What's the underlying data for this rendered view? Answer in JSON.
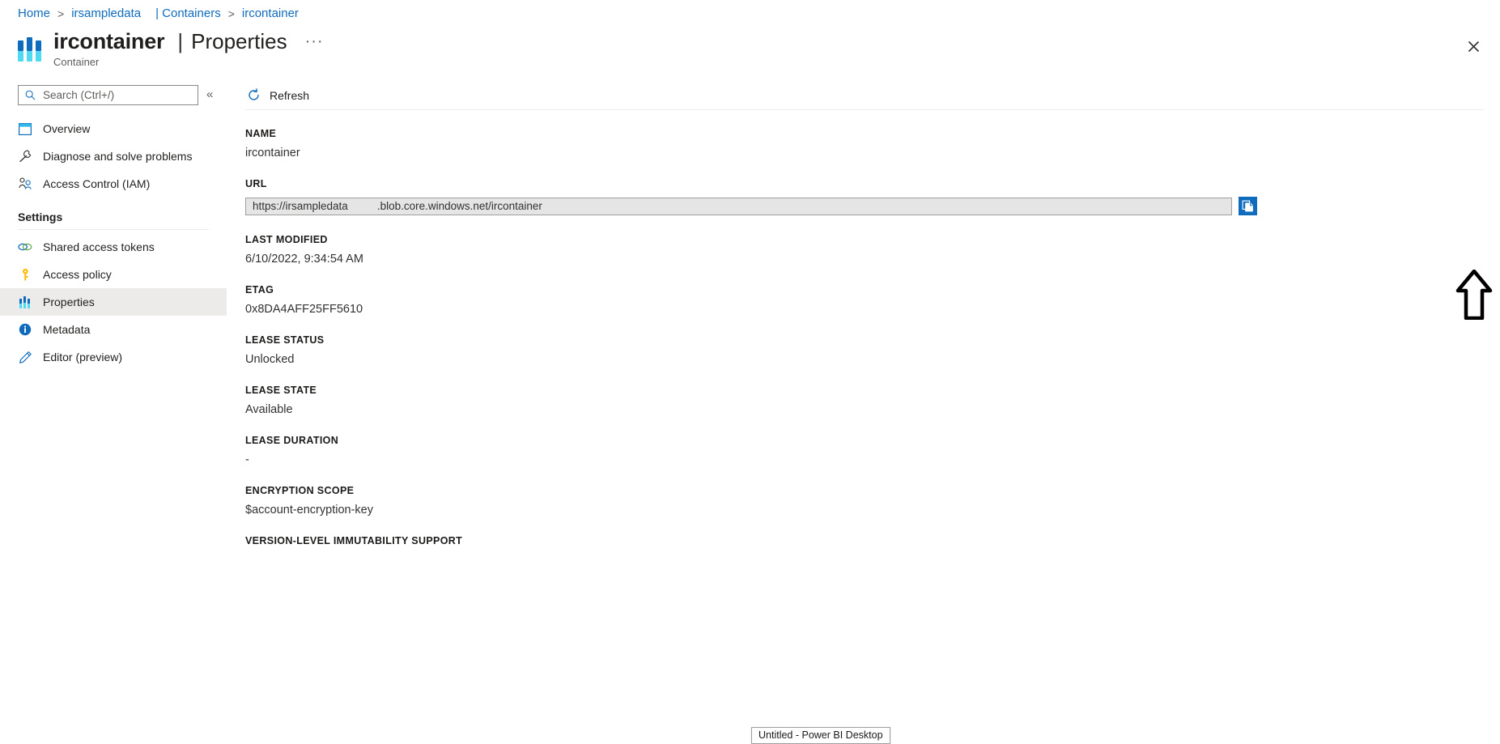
{
  "breadcrumb": {
    "items": [
      {
        "label": "Home",
        "sep": ">"
      },
      {
        "label": "irsampledata",
        "sep": ""
      },
      {
        "label": "| Containers",
        "sep": ">"
      },
      {
        "label": "ircontainer",
        "sep": ""
      }
    ]
  },
  "header": {
    "title": "ircontainer",
    "separator": "|",
    "page": "Properties",
    "more_label": "···",
    "subtitle": "Container",
    "close_label": "✕"
  },
  "sidebar": {
    "search_placeholder": "Search (Ctrl+/)",
    "search_value": "",
    "collapse_label": "«",
    "items": [
      {
        "label": "Overview",
        "icon": "overview-icon",
        "selected": false
      },
      {
        "label": "Diagnose and solve problems",
        "icon": "wrench-icon",
        "selected": false
      },
      {
        "label": "Access Control (IAM)",
        "icon": "people-icon",
        "selected": false
      }
    ],
    "group_label": "Settings",
    "settings_items": [
      {
        "label": "Shared access tokens",
        "icon": "link-icon",
        "selected": false
      },
      {
        "label": "Access policy",
        "icon": "key-icon",
        "selected": false
      },
      {
        "label": "Properties",
        "icon": "container-icon",
        "selected": true
      },
      {
        "label": "Metadata",
        "icon": "info-icon",
        "selected": false
      },
      {
        "label": "Editor (preview)",
        "icon": "pencil-icon",
        "selected": false
      }
    ]
  },
  "toolbar": {
    "refresh_label": "Refresh"
  },
  "properties": [
    {
      "label": "NAME",
      "value": "ircontainer",
      "type": "text"
    },
    {
      "label": "URL",
      "type": "url",
      "url_prefix": "https://irsampledata",
      "url_suffix": ".blob.core.windows.net/ircontainer",
      "copy_title": "Copy to clipboard"
    },
    {
      "label": "LAST MODIFIED",
      "value": "6/10/2022, 9:34:54 AM",
      "type": "text"
    },
    {
      "label": "ETAG",
      "value": "0x8DA4AFF25FF5610",
      "type": "text"
    },
    {
      "label": "LEASE STATUS",
      "value": "Unlocked",
      "type": "text"
    },
    {
      "label": "LEASE STATE",
      "value": "Available",
      "type": "text"
    },
    {
      "label": "LEASE DURATION",
      "value": "-",
      "type": "text"
    },
    {
      "label": "ENCRYPTION SCOPE",
      "value": "$account-encryption-key",
      "type": "text"
    },
    {
      "label": "VERSION-LEVEL IMMUTABILITY SUPPORT",
      "value": "",
      "type": "text"
    }
  ],
  "taskbar": {
    "tooltip": "Untitled - Power BI Desktop"
  },
  "colors": {
    "accent": "#0f6cbd",
    "link": "#0f6cbd",
    "selected_bg": "#edebe9",
    "copy_button_bg": "#0f6cbd",
    "url_field_bg": "#e5e5e5",
    "icon_cyan": "#50d9f2",
    "key_yellow": "#ffb900"
  }
}
